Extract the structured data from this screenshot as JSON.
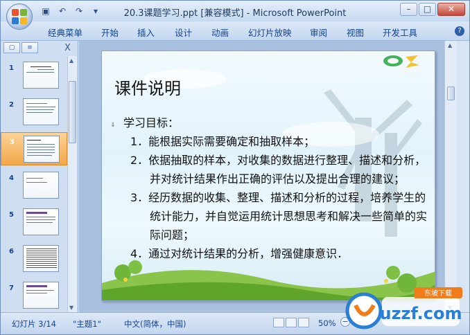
{
  "window": {
    "title": "20.3课题学习.ppt [兼容模式] - Microsoft PowerPoint",
    "min": "–",
    "max": "□",
    "close": "✕"
  },
  "qat": {
    "save": "▣",
    "undo": "↶",
    "redo": "↷",
    "customize": "▾"
  },
  "ribbon": {
    "tabs": [
      "经典菜单",
      "开始",
      "插入",
      "设计",
      "动画",
      "幻灯片放映",
      "审阅",
      "视图",
      "开发工具"
    ],
    "help": "?"
  },
  "left_pane": {
    "close": "X",
    "slides": [
      {
        "num": "1",
        "selected": false
      },
      {
        "num": "2",
        "selected": false
      },
      {
        "num": "3",
        "selected": true
      },
      {
        "num": "4",
        "selected": false
      },
      {
        "num": "5",
        "selected": false
      },
      {
        "num": "6",
        "selected": false
      },
      {
        "num": "7",
        "selected": false
      }
    ]
  },
  "slide": {
    "title": "课件说明",
    "bullet_mark": "⇓",
    "intro": "学习目标：",
    "items": [
      "1．能根据实际需要确定和抽取样本；",
      "2．依据抽取的样本，对收集的数据进行整理、描述和分析，并对统计结果作出正确的评估以及提出合理的建议；",
      "3．经历数据的收集、整理、描述和分析的过程，培养学生的统计能力，并自觉运用统计思想思考和解决一些简单的实际问题；",
      "4．通过对统计结果的分析，增强健康意识．"
    ]
  },
  "status": {
    "slide_info": "幻灯片 3/14",
    "theme": "\"主题1\"",
    "language": "中文(简体，中国)",
    "zoom": "50%",
    "zoom_minus": "−"
  },
  "watermark": {
    "text": "uzzf.com",
    "tagline": "东坡下载"
  },
  "colors": {
    "accent": "#15428b",
    "selected_thumb": "#f3a74a",
    "ribbon_bg": "#c4d7f0"
  }
}
